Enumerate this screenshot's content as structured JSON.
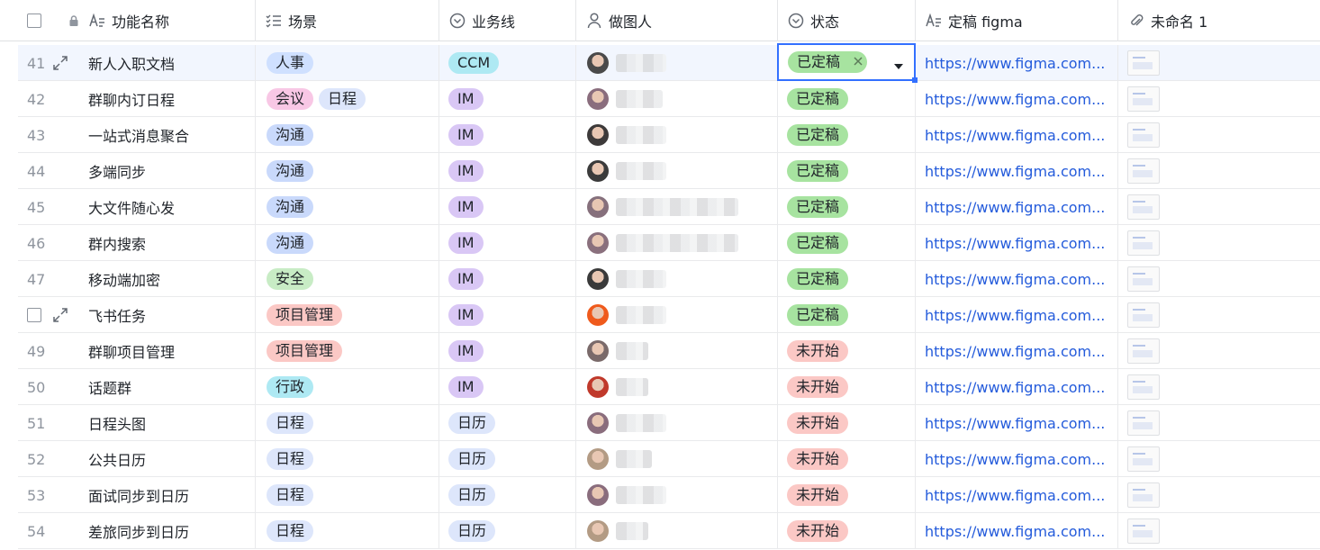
{
  "columns": {
    "name": "功能名称",
    "scene": "场景",
    "business": "业务线",
    "designer": "做图人",
    "status": "状态",
    "figma": "定稿 figma",
    "attachment": "未命名 1"
  },
  "colors": {
    "tag_renshi": "#cfe0ff",
    "tag_huiyi": "#f8c7e5",
    "tag_richeng": "#dde6fb",
    "tag_goutong": "#c9d9fb",
    "tag_anquan": "#c8ecc5",
    "tag_xiangmu": "#fbc8c5",
    "tag_xingzheng": "#aee9f3",
    "biz_ccm": "#aee9f3",
    "biz_im": "#d9c7f5",
    "biz_rili": "#dde6fb",
    "status_done": "#a7e3a0",
    "status_todo": "#fbc8c5",
    "link": "#245bdb",
    "selection": "#3370ff"
  },
  "rows": [
    {
      "num": "41",
      "name": "新人入职文档",
      "scenes": [
        "人事"
      ],
      "biz": "CCM",
      "status": "已定稿",
      "link": "https://www.figma.com..."
    },
    {
      "num": "42",
      "name": "群聊内订日程",
      "scenes": [
        "会议",
        "日程"
      ],
      "biz": "IM",
      "status": "已定稿",
      "link": "https://www.figma.com..."
    },
    {
      "num": "43",
      "name": "一站式消息聚合",
      "scenes": [
        "沟通"
      ],
      "biz": "IM",
      "status": "已定稿",
      "link": "https://www.figma.com..."
    },
    {
      "num": "44",
      "name": "多端同步",
      "scenes": [
        "沟通"
      ],
      "biz": "IM",
      "status": "已定稿",
      "link": "https://www.figma.com..."
    },
    {
      "num": "45",
      "name": "大文件随心发",
      "scenes": [
        "沟通"
      ],
      "biz": "IM",
      "status": "已定稿",
      "link": "https://www.figma.com..."
    },
    {
      "num": "46",
      "name": "群内搜索",
      "scenes": [
        "沟通"
      ],
      "biz": "IM",
      "status": "已定稿",
      "link": "https://www.figma.com..."
    },
    {
      "num": "47",
      "name": "移动端加密",
      "scenes": [
        "安全"
      ],
      "biz": "IM",
      "status": "已定稿",
      "link": "https://www.figma.com..."
    },
    {
      "num": "",
      "name": "飞书任务",
      "scenes": [
        "项目管理"
      ],
      "biz": "IM",
      "status": "已定稿",
      "link": "https://www.figma.com..."
    },
    {
      "num": "49",
      "name": "群聊项目管理",
      "scenes": [
        "项目管理"
      ],
      "biz": "IM",
      "status": "未开始",
      "link": "https://www.figma.com..."
    },
    {
      "num": "50",
      "name": "话题群",
      "scenes": [
        "行政"
      ],
      "biz": "IM",
      "status": "未开始",
      "link": "https://www.figma.com..."
    },
    {
      "num": "51",
      "name": "日程头图",
      "scenes": [
        "日程"
      ],
      "biz": "日历",
      "status": "未开始",
      "link": "https://www.figma.com..."
    },
    {
      "num": "52",
      "name": "公共日历",
      "scenes": [
        "日程"
      ],
      "biz": "日历",
      "status": "未开始",
      "link": "https://www.figma.com..."
    },
    {
      "num": "53",
      "name": "面试同步到日历",
      "scenes": [
        "日程"
      ],
      "biz": "日历",
      "status": "未开始",
      "link": "https://www.figma.com..."
    },
    {
      "num": "54",
      "name": "差旅同步到日历",
      "scenes": [
        "日程"
      ],
      "biz": "日历",
      "status": "未开始",
      "link": "https://www.figma.com..."
    }
  ],
  "edit_cell": {
    "value": "已定稿",
    "clear_icon": "close-icon",
    "dropdown_icon": "caret-down-icon"
  }
}
